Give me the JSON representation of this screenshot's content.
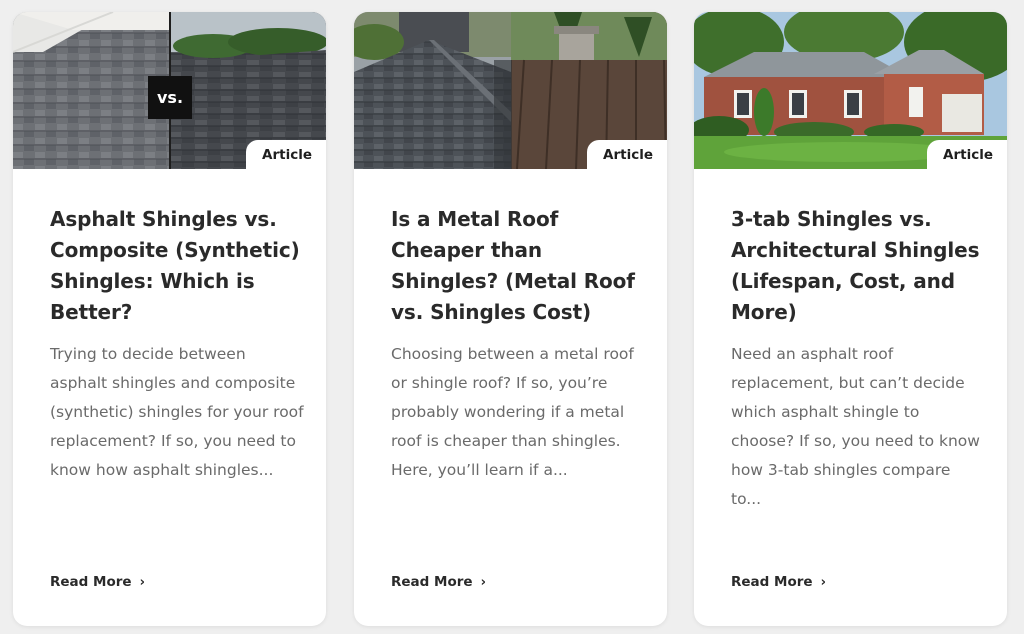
{
  "cards": [
    {
      "badge": "Article",
      "vs_label": "vs.",
      "title": "Asphalt Shingles vs. Composite (Synthetic) Shingles: Which is Better?",
      "excerpt": "Trying to decide between asphalt shingles and composite (synthetic) shingles for your roof replacement? If so, you need to know how asphalt shingles...",
      "read_more": "Read More",
      "read_more_icon": "chevron-right-icon"
    },
    {
      "badge": "Article",
      "title": "Is a Metal Roof Cheaper than Shingles? (Metal Roof vs. Shingles Cost)",
      "excerpt": "Choosing between a metal roof or shingle roof? If so, you’re probably wondering if a metal roof is cheaper than shingles. Here, you’ll learn if a...",
      "read_more": "Read More",
      "read_more_icon": "chevron-right-icon"
    },
    {
      "badge": "Article",
      "title": "3-tab Shingles vs. Architectural Shingles (Lifespan, Cost, and More)",
      "excerpt": "Need an asphalt roof replacement, but can’t decide which asphalt shingle to choose? If so, you need to know how 3-tab shingles compare to...",
      "read_more": "Read More",
      "read_more_icon": "chevron-right-icon"
    }
  ],
  "chevron_glyph": "›",
  "colors": {
    "card_bg": "#ffffff",
    "page_bg": "#efefef",
    "title": "#2a2a2a",
    "excerpt": "#6a6a6a"
  }
}
